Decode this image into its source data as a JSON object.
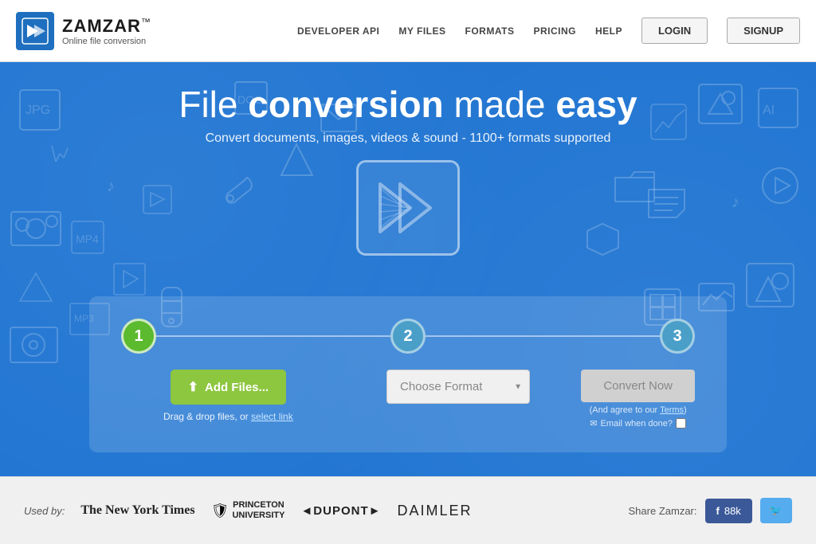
{
  "header": {
    "logo_name": "ZAMZAR",
    "logo_tm": "™",
    "logo_tagline": "Online file conversion",
    "nav": {
      "developer_api": "DEVELOPER API",
      "my_files": "MY FILES",
      "formats": "FORMATS",
      "pricing": "PRICING",
      "help": "HELP",
      "login": "LOGIN",
      "signup": "SIGNUP"
    }
  },
  "hero": {
    "title_start": "File ",
    "title_bold": "conversion",
    "title_end": " made ",
    "title_strong": "easy",
    "subtitle": "Convert documents, images, videos & sound - 1100+ formats supported"
  },
  "steps": {
    "step1_number": "1",
    "step2_number": "2",
    "step3_number": "3",
    "add_files_label": "Add Files...",
    "drag_drop_text": "Drag & drop files, or",
    "select_link_text": "select link",
    "choose_format_placeholder": "Choose Format",
    "convert_now_label": "Convert Now",
    "terms_text": "(And agree to our",
    "terms_link": "Terms",
    "terms_end": ")",
    "email_label": "Email when done?",
    "upload_icon": "⬆"
  },
  "footer": {
    "used_by_label": "Used by:",
    "brands": [
      {
        "name": "The New York Times",
        "style": "nyt"
      },
      {
        "name": "PRINCETON\nUNIVERSITY",
        "style": "princeton"
      },
      {
        "name": "◄DUPONT►",
        "style": "dupont"
      },
      {
        "name": "DAIMLER",
        "style": "daimler"
      }
    ],
    "share_label": "Share Zamzar:",
    "facebook_label": "f",
    "facebook_count": "88k",
    "twitter_icon": "🐦"
  }
}
